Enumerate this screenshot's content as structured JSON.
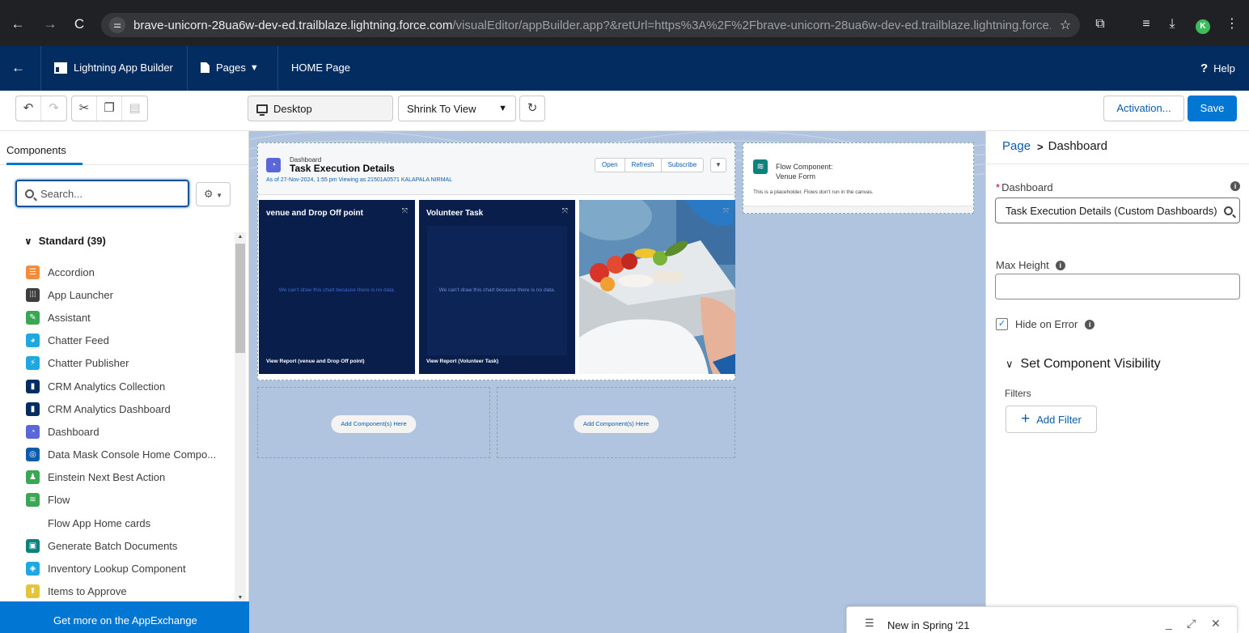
{
  "browser": {
    "url_host": "brave-unicorn-28ua6w-dev-ed.trailblaze.lightning.force.com",
    "url_rest": "/visualEditor/appBuilder.app?&retUrl=https%3A%2F%2Fbrave-unicorn-28ua6w-dev-ed.trailblaze.lightning.force.com%2...",
    "profile_initial": "K"
  },
  "header": {
    "app_name": "Lightning App Builder",
    "pages_label": "Pages",
    "page_name": "HOME Page",
    "help_label": "Help"
  },
  "toolbar": {
    "device": "Desktop",
    "zoom": "Shrink To View",
    "activation_label": "Activation...",
    "save_label": "Save"
  },
  "left_panel": {
    "tab_label": "Components",
    "search_placeholder": "Search...",
    "section_label": "Standard (39)",
    "components": [
      {
        "label": "Accordion",
        "icon": "accordion-icon",
        "color": "#f38b3c"
      },
      {
        "label": "App Launcher",
        "icon": "app-launcher-icon",
        "color": "#3e3e3c"
      },
      {
        "label": "Assistant",
        "icon": "assistant-icon",
        "color": "#3ba755"
      },
      {
        "label": "Chatter Feed",
        "icon": "chatter-feed-icon",
        "color": "#1fa7e0"
      },
      {
        "label": "Chatter Publisher",
        "icon": "chatter-publisher-icon",
        "color": "#1fa7e0"
      },
      {
        "label": "CRM Analytics Collection",
        "icon": "analytics-icon",
        "color": "#032d60"
      },
      {
        "label": "CRM Analytics Dashboard",
        "icon": "analytics-icon",
        "color": "#032d60"
      },
      {
        "label": "Dashboard",
        "icon": "dashboard-icon",
        "color": "#5a67d8"
      },
      {
        "label": "Data Mask Console Home Compo...",
        "icon": "data-mask-icon",
        "color": "#0b5cab"
      },
      {
        "label": "Einstein Next Best Action",
        "icon": "einstein-icon",
        "color": "#3ba755"
      },
      {
        "label": "Flow",
        "icon": "flow-icon",
        "color": "#3ba755"
      },
      {
        "label": "Flow App Home cards",
        "icon": "",
        "color": ""
      },
      {
        "label": "Generate Batch Documents",
        "icon": "batch-documents-icon",
        "color": "#0b827c"
      },
      {
        "label": "Inventory Lookup Component",
        "icon": "inventory-icon",
        "color": "#1fa7e0"
      },
      {
        "label": "Items to Approve",
        "icon": "approve-icon",
        "color": "#e4c43a"
      }
    ],
    "appexchange_label": "Get more on the AppExchange"
  },
  "canvas": {
    "dashboard": {
      "small_label": "Dashboard",
      "title": "Task Execution Details",
      "as_of": "As of 27-Nov-2024, 1:55 pm Viewing as 21501A0571 KALAPALA NIRMAL",
      "buttons": [
        "Open",
        "Refresh",
        "Subscribe"
      ],
      "widgets": [
        {
          "title": "venue and Drop Off point",
          "no_data": "We can't draw this chart because there is no data.",
          "report": "View Report (venue and Drop Off point)"
        },
        {
          "title": "Volunteer Task",
          "no_data": "We can't draw this chart because there is no data.",
          "report": "View Report (Volunteer Task)"
        }
      ]
    },
    "add_here": [
      "Add Component(s) Here",
      "Add Component(s) Here"
    ],
    "flow": {
      "title_line1": "Flow Component:",
      "title_line2": "Venue Form",
      "placeholder": "This is a placeholder. Flows don't run in the canvas."
    }
  },
  "right_panel": {
    "crumb_parent": "Page",
    "crumb_current": "Dashboard",
    "dashboard_label": "Dashboard",
    "dashboard_value": "Task Execution Details (Custom Dashboards)",
    "max_height_label": "Max Height",
    "max_height_value": "",
    "hide_on_error_label": "Hide on Error",
    "hide_on_error_checked": true,
    "visibility_label": "Set Component Visibility",
    "filters_label": "Filters",
    "add_filter_label": "Add Filter"
  },
  "popup": {
    "title": "New in Spring '21"
  }
}
